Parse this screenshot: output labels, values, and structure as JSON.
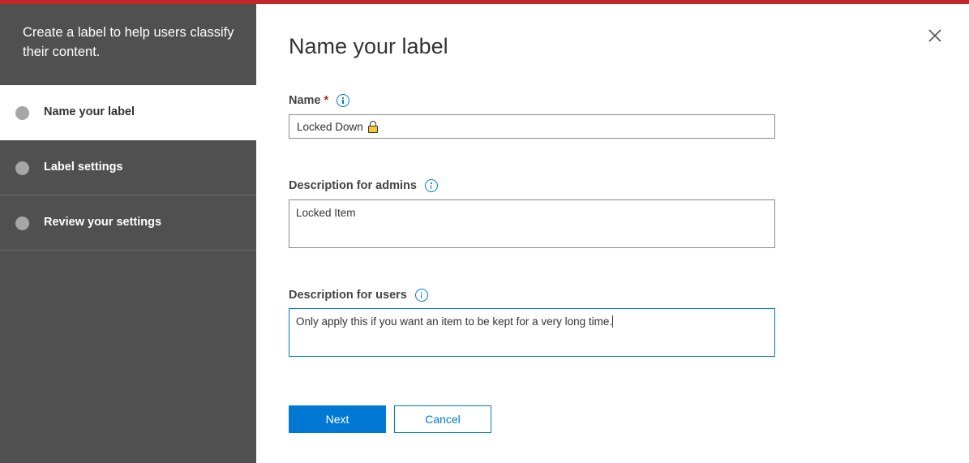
{
  "colors": {
    "accent_bar": "#c4262e",
    "sidebar_bg": "#505050",
    "primary": "#0078d4",
    "required": "#a4262c"
  },
  "sidebar": {
    "header": "Create a label to help users classify their content.",
    "steps": [
      {
        "label": "Name your label",
        "active": true
      },
      {
        "label": "Label settings",
        "active": false
      },
      {
        "label": "Review your settings",
        "active": false
      }
    ]
  },
  "main": {
    "title": "Name your label",
    "close_icon": "close-icon",
    "fields": {
      "name": {
        "label": "Name",
        "required_mark": "*",
        "value": "Locked Down",
        "value_icon": "lock-icon",
        "info_icon": "info-icon"
      },
      "admins": {
        "label": "Description for admins",
        "value": "Locked Item",
        "info_icon": "info-icon"
      },
      "users": {
        "label": "Description for users",
        "value": "Only apply this if you want an item to be kept for a very long time.",
        "info_icon": "info-icon"
      }
    },
    "buttons": {
      "next": "Next",
      "cancel": "Cancel"
    }
  }
}
